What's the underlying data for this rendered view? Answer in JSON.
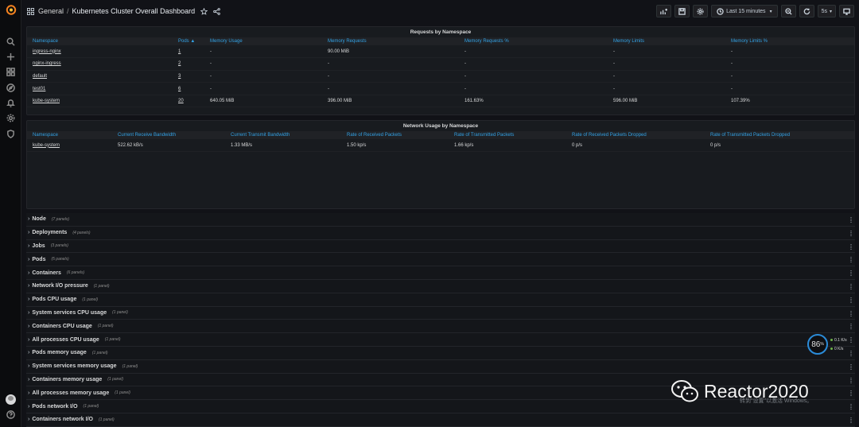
{
  "topbar": {
    "folder": "General",
    "separator": "/",
    "dashboard_title": "Kubernetes Cluster Overall Dashboard",
    "time_range": "Last 15 minutes",
    "refresh_interval": "5s"
  },
  "requests_panel": {
    "title": "Requests by Namespace",
    "columns": [
      "Namespace",
      "Pods ▲",
      "Memory Usage",
      "Memory Requests",
      "Memory Requests %",
      "Memory Limits",
      "Memory Limits %"
    ],
    "rows": [
      [
        "ingress-nginx",
        "1",
        "-",
        "90.00 MiB",
        "-",
        "-",
        "-"
      ],
      [
        "nginx-ingress",
        "2",
        "-",
        "-",
        "-",
        "-",
        "-"
      ],
      [
        "default",
        "3",
        "-",
        "-",
        "-",
        "-",
        "-"
      ],
      [
        "test01",
        "6",
        "-",
        "-",
        "-",
        "-",
        "-"
      ],
      [
        "kube-system",
        "20",
        "640.05 MiB",
        "396.00 MiB",
        "161.63%",
        "596.00 MiB",
        "107.39%"
      ]
    ]
  },
  "network_panel": {
    "title": "Network Usage by Namespace",
    "columns": [
      "Namespace",
      "Current Receive Bandwidth",
      "Current Transmit Bandwidth",
      "Rate of Received Packets",
      "Rate of Transmitted Packets",
      "Rate of Received Packets Dropped",
      "Rate of Transmitted Packets Dropped"
    ],
    "rows": [
      [
        "kube-system",
        "522.62 kB/s",
        "1.33 MB/s",
        "1.50 kp/s",
        "1.66 kp/s",
        "0 p/s",
        "0 p/s"
      ]
    ]
  },
  "collapsed_rows": [
    {
      "title": "Node",
      "count": "(7 panels)"
    },
    {
      "title": "Deployments",
      "count": "(4 panels)"
    },
    {
      "title": "Jobs",
      "count": "(3 panels)"
    },
    {
      "title": "Pods",
      "count": "(5 panels)"
    },
    {
      "title": "Containers",
      "count": "(6 panels)"
    },
    {
      "title": "Network I/O pressure",
      "count": "(1 panel)"
    },
    {
      "title": "Pods CPU usage",
      "count": "(1 panel)"
    },
    {
      "title": "System services CPU usage",
      "count": "(1 panel)"
    },
    {
      "title": "Containers CPU usage",
      "count": "(1 panel)"
    },
    {
      "title": "All processes CPU usage",
      "count": "(1 panel)"
    },
    {
      "title": "Pods memory usage",
      "count": "(1 panel)"
    },
    {
      "title": "System services memory usage",
      "count": "(1 panel)"
    },
    {
      "title": "Containers memory usage",
      "count": "(1 panel)"
    },
    {
      "title": "All processes memory usage",
      "count": "(1 panel)"
    },
    {
      "title": "Pods network I/O",
      "count": "(1 panel)"
    },
    {
      "title": "Containers network I/O",
      "count": "(1 panel)"
    }
  ],
  "overlay": {
    "gauge_value": "86",
    "gauge_unit": "%",
    "upload_rate": "0.1",
    "upload_unit": "K/s",
    "download_rate": "0",
    "download_unit": "K/s",
    "watermark_text": "Reactor2020",
    "windows_notice": "转到\"设置\"以激活 Windows。"
  },
  "colors": {
    "accent_blue": "#33a2e5",
    "background": "#111217",
    "panel": "#181b1f"
  }
}
